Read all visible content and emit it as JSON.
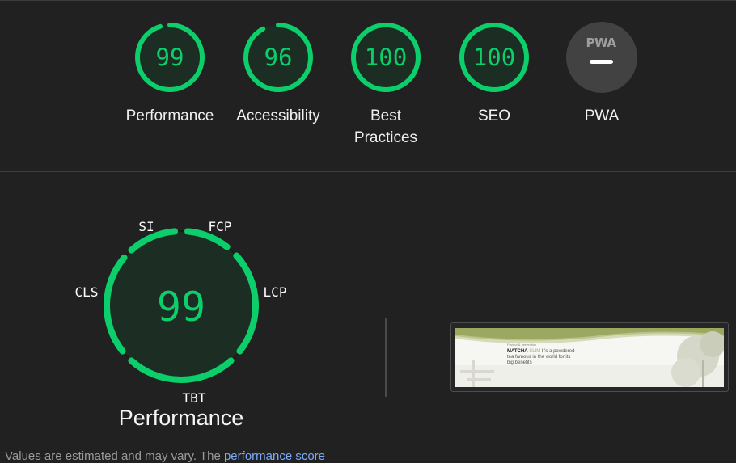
{
  "gauges": [
    {
      "name": "performance",
      "score": "99",
      "value": 99,
      "label": "Performance"
    },
    {
      "name": "accessibility",
      "score": "96",
      "value": 96,
      "label": "Accessibility"
    },
    {
      "name": "best-practices",
      "score": "100",
      "value": 100,
      "label": "Best Practices"
    },
    {
      "name": "seo",
      "score": "100",
      "value": 100,
      "label": "SEO"
    },
    {
      "name": "pwa",
      "label": "PWA",
      "badge": "PWA"
    }
  ],
  "performance_detail": {
    "score": "99",
    "title": "Performance",
    "metrics": [
      "SI",
      "FCP",
      "LCP",
      "TBT",
      "CLS"
    ]
  },
  "thumbnail": {
    "small_line": "Protect & prevention",
    "brand": "MATCHA",
    "brand_accent": "SLIM",
    "line1": " It's a powdered",
    "line2": "tea famous in the world for its",
    "line3": "big benefits"
  },
  "footer": {
    "text": "Values are estimated and may vary. The ",
    "link": "performance score"
  },
  "colors": {
    "pass": "#0cce6b",
    "pass_bg": "#1c2e23",
    "background": "#212121",
    "pwa_bg": "#424242"
  }
}
